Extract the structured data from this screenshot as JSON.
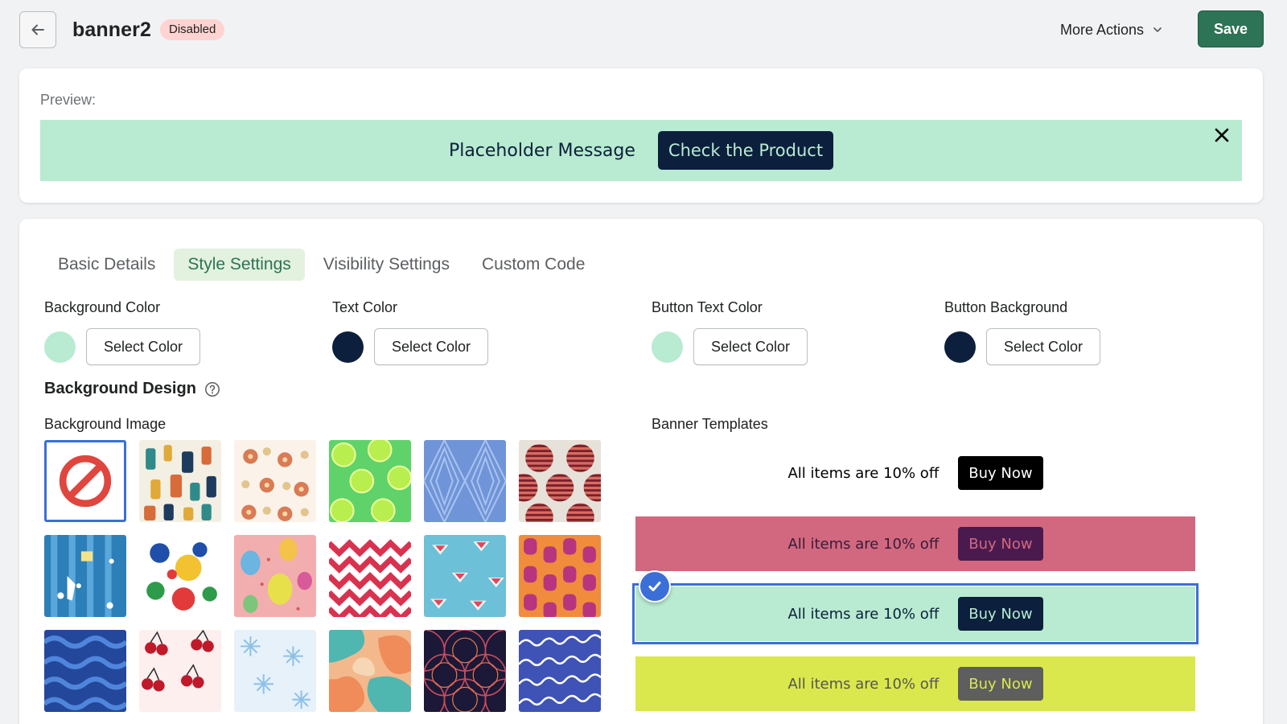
{
  "header": {
    "title": "banner2",
    "status": "Disabled",
    "more_actions": "More Actions",
    "save": "Save"
  },
  "preview": {
    "label": "Preview:",
    "message": "Placeholder Message",
    "button": "Check the Product",
    "background": "#b8ebd1",
    "text_color": "#0d1f3b"
  },
  "tabs": [
    {
      "label": "Basic Details",
      "active": false
    },
    {
      "label": "Style Settings",
      "active": true
    },
    {
      "label": "Visibility Settings",
      "active": false
    },
    {
      "label": "Custom Code",
      "active": false
    }
  ],
  "colors": [
    {
      "label": "Background Color",
      "swatch": "#b8ebd1",
      "button": "Select Color"
    },
    {
      "label": "Text Color",
      "swatch": "#0c1f3c",
      "button": "Select Color"
    },
    {
      "label": "Button Text Color",
      "swatch": "#b8ebd1",
      "button": "Select Color"
    },
    {
      "label": "Button Background",
      "swatch": "#0c1f3c",
      "button": "Select Color"
    }
  ],
  "background_design": {
    "title": "Background Design",
    "image_label": "Background Image",
    "patterns": [
      "none",
      "bottles",
      "flowers",
      "limes",
      "diamonds",
      "striped-dots",
      "christmas",
      "paint-splash",
      "easter-eggs",
      "chevron",
      "cocktails",
      "beads",
      "waves",
      "cherries",
      "snowflakes",
      "camouflage",
      "scales",
      "sea-waves"
    ],
    "selected_pattern": "none"
  },
  "templates": {
    "label": "Banner Templates",
    "items": [
      {
        "text": "All items are 10% off",
        "button": "Buy Now",
        "bg": "#ffffff",
        "fg": "#000000",
        "btn_bg": "#000000",
        "btn_fg": "#ffffff"
      },
      {
        "text": "All items are 10% off",
        "button": "Buy Now",
        "bg": "#d2687f",
        "fg": "#3a1a3a",
        "btn_bg": "#4a1a4f",
        "btn_fg": "#d2687f"
      },
      {
        "text": "All items are 10% off",
        "button": "Buy Now",
        "bg": "#b8ebd1",
        "fg": "#0d1f3b",
        "btn_bg": "#0c1f3c",
        "btn_fg": "#b8ebd1"
      },
      {
        "text": "All items are 10% off",
        "button": "Buy Now",
        "bg": "#dbe84d",
        "fg": "#555555",
        "btn_bg": "#5e5e5e",
        "btn_fg": "#dbe84d"
      }
    ],
    "selected_index": 2
  }
}
